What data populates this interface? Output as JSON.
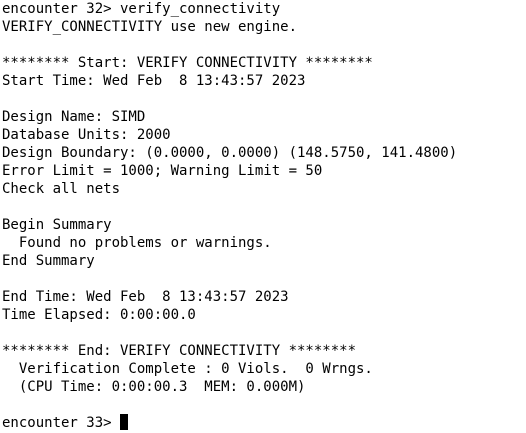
{
  "terminal": {
    "lines": [
      "encounter 32> verify_connectivity",
      "VERIFY_CONNECTIVITY use new engine.",
      "",
      "******** Start: VERIFY CONNECTIVITY ********",
      "Start Time: Wed Feb  8 13:43:57 2023",
      "",
      "Design Name: SIMD",
      "Database Units: 2000",
      "Design Boundary: (0.0000, 0.0000) (148.5750, 141.4800)",
      "Error Limit = 1000; Warning Limit = 50",
      "Check all nets",
      "",
      "Begin Summary",
      "  Found no problems or warnings.",
      "End Summary",
      "",
      "End Time: Wed Feb  8 13:43:57 2023",
      "Time Elapsed: 0:00:00.0",
      "",
      "******** End: VERIFY CONNECTIVITY ********",
      "  Verification Complete : 0 Viols.  0 Wrngs.",
      "  (CPU Time: 0:00:00.3  MEM: 0.000M)",
      "",
      "encounter 33> "
    ]
  }
}
